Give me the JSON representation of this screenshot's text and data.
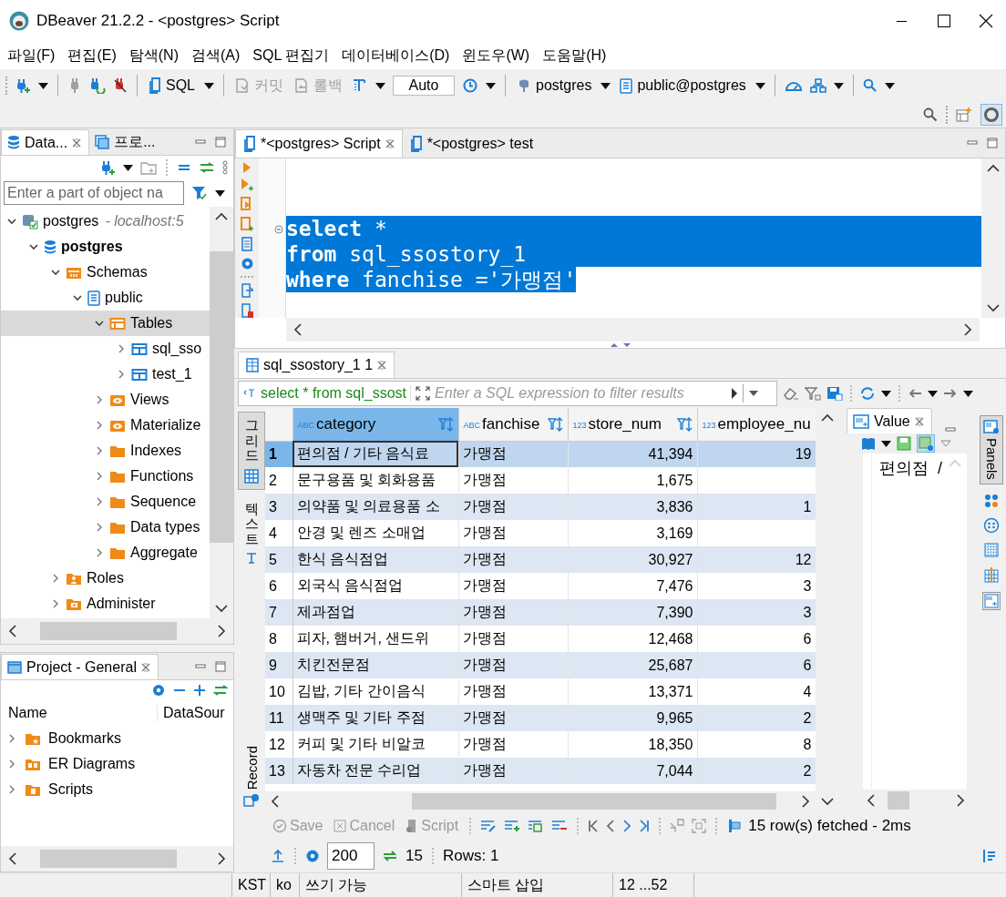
{
  "window": {
    "title": "DBeaver 21.2.2 - <postgres> Script"
  },
  "menu": [
    "파일(F)",
    "편집(E)",
    "탐색(N)",
    "검색(A)",
    "SQL 편집기",
    "데이터베이스(D)",
    "윈도우(W)",
    "도움말(H)"
  ],
  "toolbar": [
    {
      "kind": "button",
      "label": "SQL",
      "disabled": false
    },
    {
      "kind": "button",
      "label": "커밋",
      "disabled": true
    },
    {
      "kind": "button",
      "label": "롤백",
      "disabled": true
    },
    {
      "kind": "field",
      "value": "Auto"
    },
    {
      "kind": "button",
      "label": "postgres",
      "disabled": false
    },
    {
      "kind": "button",
      "label": "public@postgres",
      "disabled": false
    }
  ],
  "navigator": {
    "tabs": [
      {
        "label": "Data...",
        "selected": true
      },
      {
        "label": "프로...",
        "selected": false
      }
    ],
    "filter": {
      "placeholder": "Enter a part of object na"
    },
    "tree": [
      {
        "label": "postgres",
        "suffix": "- localhost:5",
        "kind": "connection",
        "expanded": true,
        "selected": false,
        "children": [
          {
            "label": "postgres",
            "kind": "database",
            "expanded": true,
            "selected": false,
            "children": [
              {
                "label": "Schemas",
                "kind": "schemas",
                "expanded": true,
                "selected": false,
                "children": [
                  {
                    "label": "public",
                    "kind": "schema",
                    "expanded": true,
                    "selected": false,
                    "children": [
                      {
                        "label": "Tables",
                        "kind": "tables",
                        "expanded": true,
                        "selected": true,
                        "children": [
                          {
                            "label": "sql_sso",
                            "kind": "table",
                            "expanded": false,
                            "selected": false
                          },
                          {
                            "label": "test_1",
                            "kind": "table",
                            "expanded": false,
                            "selected": false
                          }
                        ]
                      },
                      {
                        "label": "Views",
                        "kind": "views",
                        "expanded": false,
                        "selected": false
                      },
                      {
                        "label": "Materialize",
                        "kind": "views",
                        "expanded": false,
                        "selected": false
                      },
                      {
                        "label": "Indexes",
                        "kind": "folder",
                        "expanded": false,
                        "selected": false
                      },
                      {
                        "label": "Functions",
                        "kind": "folder",
                        "expanded": false,
                        "selected": false
                      },
                      {
                        "label": "Sequence",
                        "kind": "folder",
                        "expanded": false,
                        "selected": false
                      },
                      {
                        "label": "Data types",
                        "kind": "folder",
                        "expanded": false,
                        "selected": false
                      },
                      {
                        "label": "Aggregate",
                        "kind": "folder",
                        "expanded": false,
                        "selected": false
                      }
                    ]
                  }
                ]
              },
              {
                "label": "Roles",
                "kind": "roles",
                "expanded": false,
                "selected": false
              },
              {
                "label": "Administer",
                "kind": "admin",
                "expanded": false,
                "selected": false
              }
            ]
          }
        ]
      }
    ]
  },
  "project": {
    "title": "Project - General",
    "columns": [
      "Name",
      "DataSour"
    ],
    "items": [
      {
        "label": "Bookmarks",
        "kind": "bookmarks",
        "expanded": false
      },
      {
        "label": "ER Diagrams",
        "kind": "erd",
        "expanded": false
      },
      {
        "label": "Scripts",
        "kind": "scripts",
        "expanded": false
      }
    ]
  },
  "editor": {
    "tabs": [
      {
        "label": "*<postgres> Script",
        "selected": true
      },
      {
        "label": "*<postgres> test",
        "selected": false
      }
    ],
    "lines": [
      {
        "text": "**select** *",
        "selected": true
      },
      {
        "text": "**from** sql_ssostory_1",
        "selected": true
      },
      {
        "text": "**where** fanchise ='가맹점'",
        "selected": true
      }
    ]
  },
  "results": {
    "tab": "sql_ssostory_1 1",
    "query": "select * from sql_ssost",
    "filter": {
      "placeholder": "Enter a SQL expression to filter results"
    },
    "views": [
      {
        "label": "그리드",
        "selected": true
      },
      {
        "label": "텍스트",
        "selected": false
      }
    ],
    "record": "Record",
    "columns": [
      {
        "name": "category",
        "type_label": "ABC",
        "kind": "text",
        "selected": true
      },
      {
        "name": "fanchise",
        "type_label": "ABC",
        "kind": "text",
        "selected": false
      },
      {
        "name": "store_num",
        "type_label": "123",
        "kind": "number",
        "selected": false
      },
      {
        "name": "employee_nu",
        "type_label": "123",
        "kind": "number",
        "selected": false
      }
    ],
    "rows": [
      {
        "num": "1",
        "cells": [
          "편의점 / 기타 음식료",
          "가맹점",
          "41,394",
          "19"
        ],
        "selected": true
      },
      {
        "num": "2",
        "cells": [
          "문구용품 및 회화용품",
          "가맹점",
          "1,675"
        ],
        "selected": false
      },
      {
        "num": "3",
        "cells": [
          "의약품 및 의료용품 소",
          "가맹점",
          "3,836",
          "1"
        ],
        "selected": false
      },
      {
        "num": "4",
        "cells": [
          "안경 및 렌즈 소매업",
          "가맹점",
          "3,169"
        ],
        "selected": false
      },
      {
        "num": "5",
        "cells": [
          "한식 음식점업",
          "가맹점",
          "30,927",
          "12"
        ],
        "selected": false
      },
      {
        "num": "6",
        "cells": [
          "외국식 음식점업",
          "가맹점",
          "7,476",
          "3"
        ],
        "selected": false
      },
      {
        "num": "7",
        "cells": [
          "제과점업",
          "가맹점",
          "7,390",
          "3"
        ],
        "selected": false
      },
      {
        "num": "8",
        "cells": [
          "피자, 햄버거, 샌드위",
          "가맹점",
          "12,468",
          "6"
        ],
        "selected": false
      },
      {
        "num": "9",
        "cells": [
          "치킨전문점",
          "가맹점",
          "25,687",
          "6"
        ],
        "selected": false
      },
      {
        "num": "10",
        "cells": [
          "김밥, 기타 간이음식",
          "가맹점",
          "13,371",
          "4"
        ],
        "selected": false
      },
      {
        "num": "11",
        "cells": [
          "생맥주 및 기타 주점",
          "가맹점",
          "9,965",
          "2"
        ],
        "selected": false
      },
      {
        "num": "12",
        "cells": [
          "커피 및 기타 비알코",
          "가맹점",
          "18,350",
          "8"
        ],
        "selected": false
      },
      {
        "num": "13",
        "cells": [
          "자동차 전문 수리업",
          "가맹점",
          "7,044",
          "2"
        ],
        "selected": false
      }
    ],
    "value_panel": {
      "title": "Value",
      "content": "편의점  /"
    },
    "panels_toggle": {
      "label": "Panels",
      "selected": true
    },
    "actions": [
      {
        "label": "Save",
        "disabled": true
      },
      {
        "label": "Cancel",
        "disabled": true
      },
      {
        "label": "Script",
        "disabled": true
      }
    ],
    "fetch_status": "15 row(s) fetched - 2ms",
    "fetch_size": "200",
    "fetched_count": "15",
    "row_count": "Rows: 1"
  },
  "status_bar": [
    "KST",
    "ko",
    "쓰기 가능",
    "스마트 삽입",
    "12 ...52"
  ]
}
